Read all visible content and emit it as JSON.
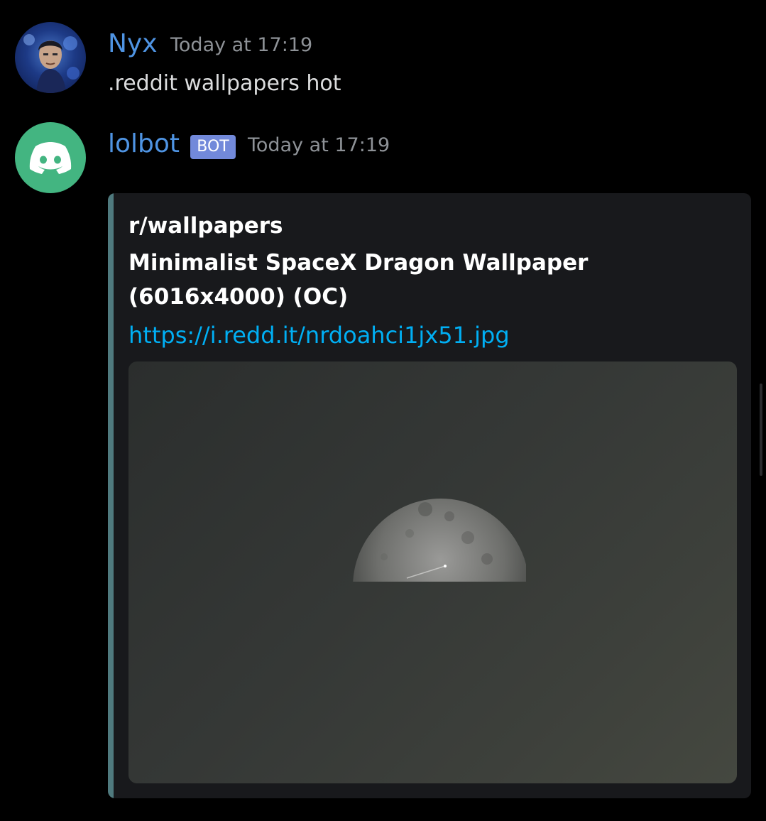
{
  "messages": [
    {
      "author": "Nyx",
      "timestamp": "Today at 17:19",
      "content": ".reddit wallpapers hot",
      "avatar_icon": "user-avatar"
    },
    {
      "author": "lolbot",
      "badge": "BOT",
      "timestamp": "Today at 17:19",
      "avatar_icon": "discord-logo-icon",
      "embed": {
        "author": "r/wallpapers",
        "title": "Minimalist SpaceX Dragon Wallpaper (6016x4000) (OC)",
        "link": "https://i.redd.it/nrdoahci1jx51.jpg",
        "image_icon": "moon-image"
      }
    }
  ],
  "colors": {
    "background": "#000000",
    "username": "#4f94e3",
    "timestamp": "#8e9297",
    "bot_badge": "#7289da",
    "bot_avatar": "#43b581",
    "embed_background": "#18191c",
    "embed_accent": "#4f7a7e",
    "link": "#00aff4"
  }
}
